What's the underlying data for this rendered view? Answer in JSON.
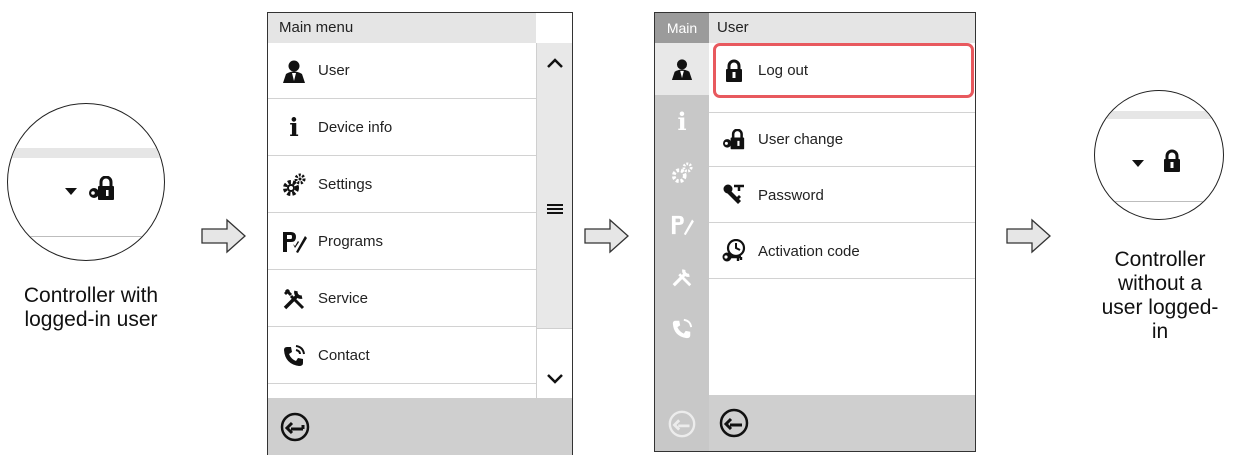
{
  "left_magnifier": {
    "caption_lines": [
      "Controller with",
      "logged-in user"
    ]
  },
  "right_magnifier": {
    "caption_lines": [
      "Controller",
      "without a",
      "user logged-",
      "in"
    ]
  },
  "main_menu_screen": {
    "title": "Main menu",
    "items": [
      {
        "label": "User",
        "icon": "user-icon"
      },
      {
        "label": "Device info",
        "icon": "info-icon"
      },
      {
        "label": "Settings",
        "icon": "settings-gears-icon"
      },
      {
        "label": "Programs",
        "icon": "programs-icon"
      },
      {
        "label": "Service",
        "icon": "service-tools-icon"
      },
      {
        "label": "Contact",
        "icon": "phone-icon"
      }
    ]
  },
  "user_screen": {
    "sidebar_title": "Main",
    "title": "User",
    "items": [
      {
        "label": "Log out",
        "icon": "lock-icon",
        "highlighted": true
      },
      {
        "label": "User change",
        "icon": "key-lock-icon"
      },
      {
        "label": "Password",
        "icon": "password-key-icon"
      },
      {
        "label": "Activation code",
        "icon": "activation-code-icon"
      }
    ],
    "highlight_color": "#e8595e"
  }
}
